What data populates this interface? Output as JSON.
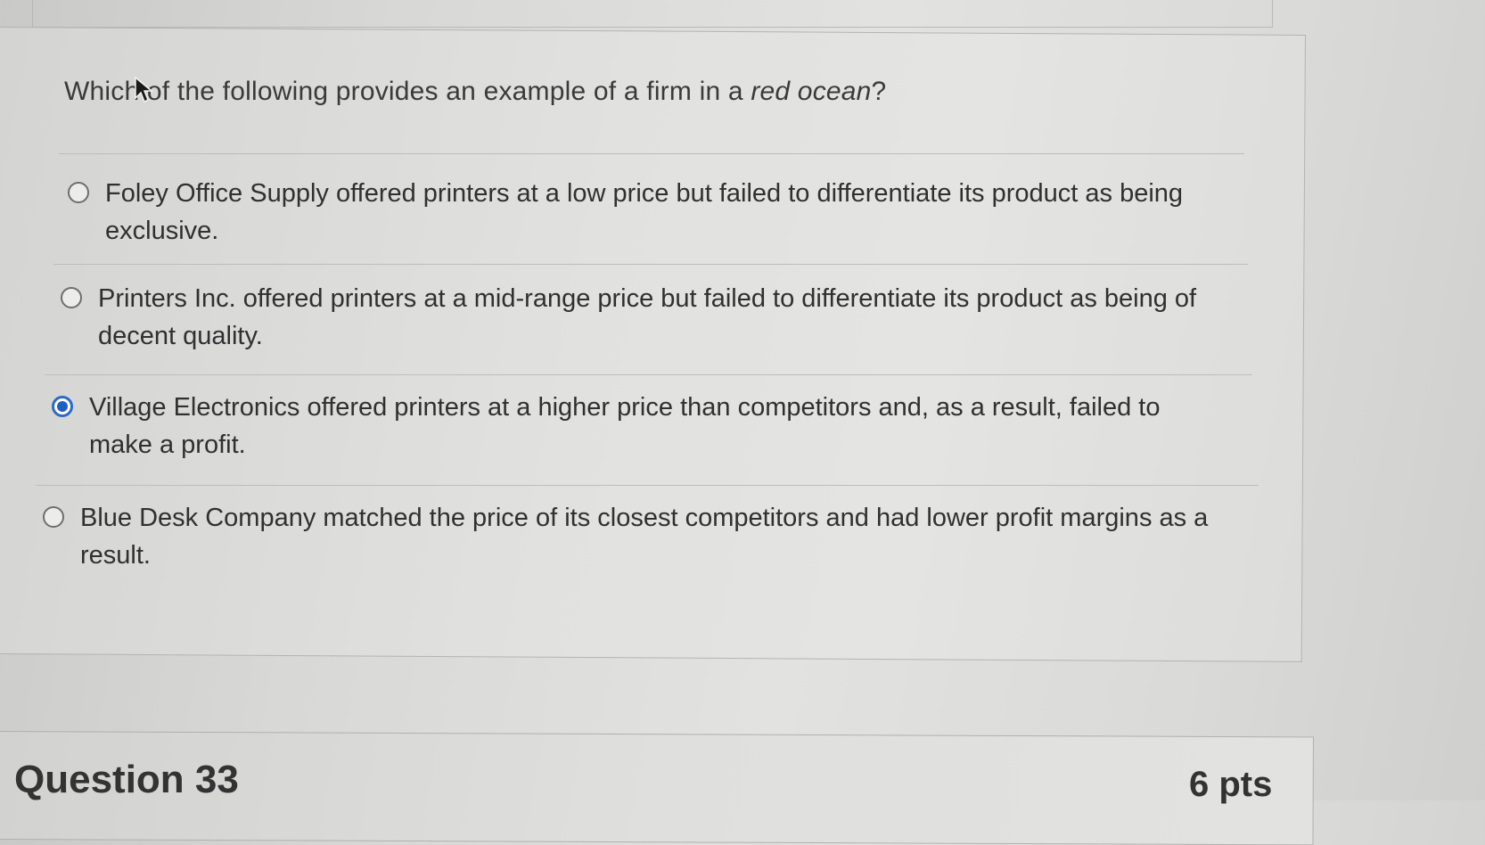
{
  "question": {
    "prompt_before": "Which of the following provides an example of a firm in a ",
    "prompt_emphasis": "red ocean",
    "prompt_after": "?"
  },
  "options": [
    {
      "label": "Foley Office Supply offered printers at a low price but failed to differentiate its product as being exclusive.",
      "selected": false
    },
    {
      "label": "Printers Inc. offered printers at a mid-range price but failed to differentiate its product as being of decent quality.",
      "selected": false
    },
    {
      "label": "Village Electronics offered printers at a higher price than competitors and, as a result, failed to make a profit.",
      "selected": true
    },
    {
      "label": "Blue Desk Company matched the price of its closest competitors and had lower profit margins as a result.",
      "selected": false
    }
  ],
  "next_question": {
    "title": "Question 33",
    "points": "6 pts"
  },
  "colors": {
    "selected_radio": "#1f5fc4"
  }
}
